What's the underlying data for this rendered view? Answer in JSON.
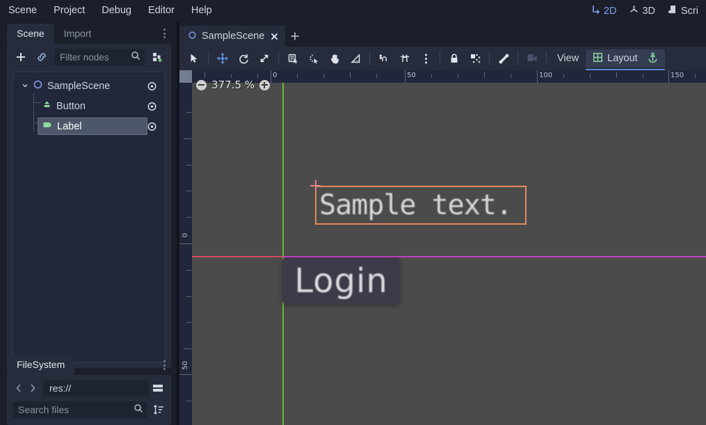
{
  "menubar": {
    "items": [
      {
        "label": "Scene"
      },
      {
        "label": "Project"
      },
      {
        "label": "Debug"
      },
      {
        "label": "Editor"
      },
      {
        "label": "Help"
      }
    ],
    "modes": [
      {
        "label": "2D",
        "icon": "axis-2d-icon",
        "active": true
      },
      {
        "label": "3D",
        "icon": "axis-3d-icon",
        "active": false
      },
      {
        "label": "Scri",
        "icon": "script-icon",
        "active": false
      }
    ]
  },
  "left_dock": {
    "tabs": [
      {
        "label": "Scene",
        "active": true
      },
      {
        "label": "Import",
        "active": false
      }
    ],
    "menu_icon": "vertical-dots-icon",
    "toolbar": {
      "add_icon": "plus-icon",
      "link_icon": "link-icon",
      "filter_placeholder": "Filter nodes",
      "search_icon": "search-icon",
      "instance_icon": "instance-child-scene-icon"
    },
    "tree": [
      {
        "label": "SampleScene",
        "icon": "node2d-icon",
        "depth": 0,
        "selected": false,
        "expanded": true,
        "visibility_icon": "eye-icon"
      },
      {
        "label": "Button",
        "icon": "button-node-icon",
        "depth": 1,
        "selected": false,
        "visibility_icon": "eye-icon"
      },
      {
        "label": "Label",
        "icon": "label-node-icon",
        "depth": 1,
        "selected": true,
        "visibility_icon": "eye-icon"
      }
    ]
  },
  "filesystem": {
    "tabs": [
      {
        "label": "FileSystem",
        "active": true
      }
    ],
    "menu_icon": "vertical-dots-icon",
    "back_icon": "chevron-left-icon",
    "forward_icon": "chevron-right-icon",
    "path": "res://",
    "split_icon": "split-view-icon",
    "search_placeholder": "Search files",
    "search_icon": "search-icon",
    "sort_icon": "sort-icon"
  },
  "editor": {
    "scene_tabs": [
      {
        "label": "SampleScene",
        "icon": "node2d-icon",
        "close_icon": "close-icon",
        "active": true
      }
    ],
    "add_tab_icon": "plus-icon",
    "canvas_toolbar": {
      "tools": [
        {
          "name": "select-mode",
          "icon": "cursor-arrow-icon",
          "active": false
        },
        {
          "name": "move-mode",
          "icon": "move-icon",
          "active": true
        },
        {
          "name": "rotate-mode",
          "icon": "rotate-icon",
          "active": false
        },
        {
          "name": "scale-mode",
          "icon": "scale-icon",
          "active": false
        },
        {
          "name": "list-select-mode",
          "icon": "list-select-icon",
          "active": false
        },
        {
          "name": "pivot-mode",
          "icon": "set-pivot-icon",
          "active": false
        },
        {
          "name": "pan-mode",
          "icon": "hand-icon",
          "active": false
        },
        {
          "name": "ruler-mode",
          "icon": "ruler-icon",
          "active": false
        },
        {
          "name": "toggle-snap",
          "icon": "snap-icon",
          "active": false
        },
        {
          "name": "smart-snap",
          "icon": "smart-snap-icon",
          "active": false
        },
        {
          "name": "snap-options",
          "icon": "vertical-dots-icon",
          "active": false
        },
        {
          "name": "lock-node",
          "icon": "lock-icon",
          "active": false
        },
        {
          "name": "group-node",
          "icon": "group-icon",
          "active": false
        },
        {
          "name": "skeleton-options",
          "icon": "bone-icon",
          "active": false
        },
        {
          "name": "preview-camera",
          "icon": "camera-icon",
          "active": false
        }
      ],
      "view_menu": "View",
      "layout_menu": "Layout",
      "layout_icon": "grid-icon",
      "anchor_icon": "anchor-icon"
    },
    "viewport": {
      "zoom_value": "377.5 %",
      "zoom_out_icon": "minus-circle-icon",
      "zoom_in_icon": "plus-circle-icon",
      "ruler_h_labels": [
        {
          "text": "0",
          "pos": 131
        },
        {
          "text": "50",
          "pos": 324
        },
        {
          "text": "100",
          "pos": 514
        },
        {
          "text": "150",
          "pos": 703
        }
      ],
      "ruler_v_labels": [
        {
          "text": "0",
          "pos": 249
        },
        {
          "text": "50",
          "pos": 437
        }
      ],
      "nodes": [
        {
          "name": "Button",
          "text": "Login",
          "selected": false
        },
        {
          "name": "Label",
          "text": "Sample text.",
          "selected": true
        }
      ],
      "colors": {
        "background": "#4b4b4b",
        "axis_y": "#6ebe2a",
        "axis_x": "#d34b5e",
        "guide_line": "#c53fc5",
        "selection": "#e08a5a",
        "pivot": "#e8848c"
      }
    }
  }
}
